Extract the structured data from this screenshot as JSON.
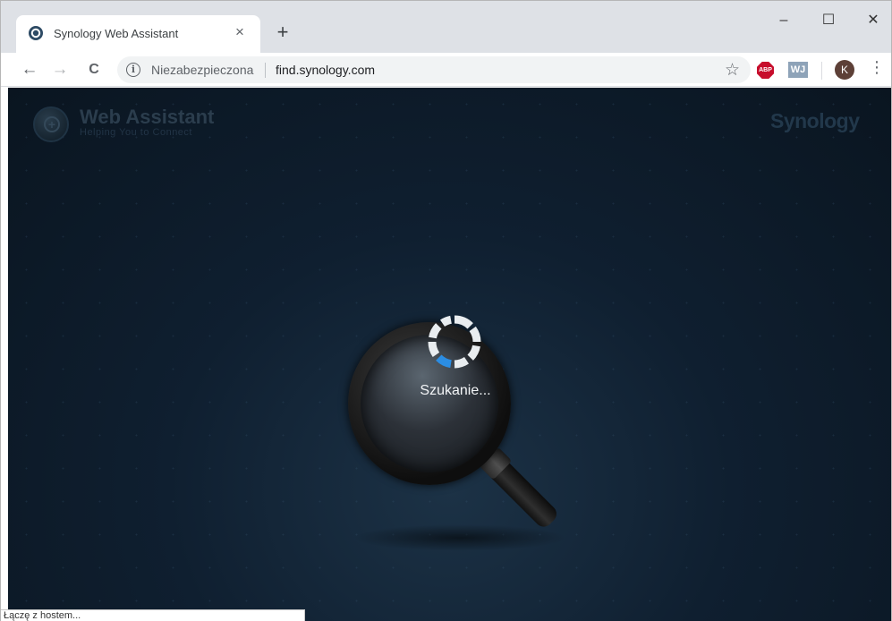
{
  "tab": {
    "title": "Synology Web Assistant",
    "close": "×",
    "new_tab": "+"
  },
  "window_controls": {
    "minimize": "–",
    "maximize": "☐",
    "close": "✕"
  },
  "toolbar": {
    "back": "←",
    "forward": "→",
    "reload": "C",
    "security_label": "Niezabezpieczona",
    "url": "find.synology.com",
    "bookmark": "☆",
    "menu": "⋮"
  },
  "extensions": {
    "abp_label": "ABP",
    "wj_label": "WJ",
    "avatar_letter": "K"
  },
  "page": {
    "brand_title": "Web Assistant",
    "brand_subtitle": "Helping You to Connect",
    "company": "Synology",
    "status_text": "Szukanie..."
  },
  "status_bar": {
    "text": "Łączę z hostem..."
  },
  "colors": {
    "accent_spinner": "#2b8de3",
    "spinner_segment": "#e9edf0",
    "page_bg": "#0f1f30"
  }
}
